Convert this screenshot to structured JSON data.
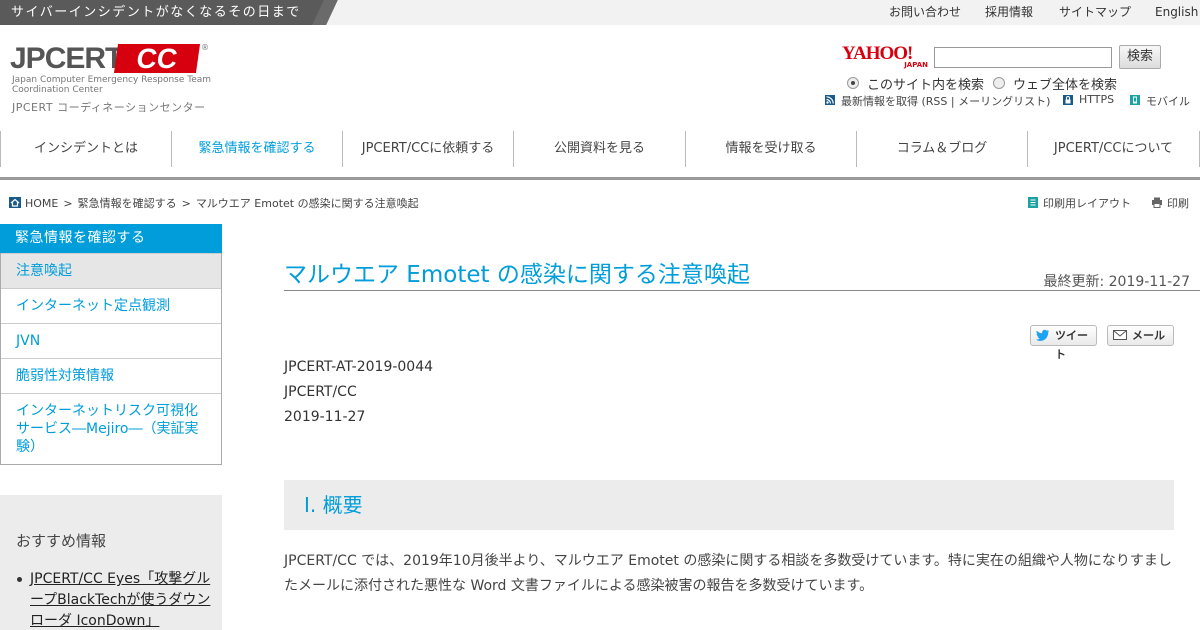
{
  "topbar": {
    "tagline": "サイバーインシデントがなくなるその日まで",
    "links": [
      "お問い合わせ",
      "採用情報",
      "サイトマップ",
      "English"
    ]
  },
  "logo": {
    "name": "JPCERT",
    "badge": "CC",
    "registered": "®",
    "english": "Japan Computer Emergency Response Team Coordination Center",
    "japanese": "JPCERT コーディネーションセンター"
  },
  "search": {
    "provider": "YAHOO!",
    "provider_sub": "JAPAN",
    "value": "",
    "button": "検索",
    "scope_site": "このサイト内を検索",
    "scope_web": "ウェブ全体を検索",
    "selected_scope": "site"
  },
  "utility_links": {
    "rss": "最新情報を取得 (RSS | メーリングリスト)",
    "https": "HTTPS",
    "mobile": "モバイル"
  },
  "nav": {
    "items": [
      "インシデントとは",
      "緊急情報を確認する",
      "JPCERT/CCに依頼する",
      "公開資料を見る",
      "情報を受け取る",
      "コラム＆ブログ",
      "JPCERT/CCについて"
    ],
    "active_index": 1
  },
  "breadcrumb": {
    "home": "HOME",
    "level1": "緊急情報を確認する",
    "current": "マルウエア Emotet の感染に関する注意喚起"
  },
  "print": {
    "layout": "印刷用レイアウト",
    "print": "印刷"
  },
  "sidebar": {
    "heading": "緊急情報を確認する",
    "items": [
      "注意喚起",
      "インターネット定点観測",
      "JVN",
      "脆弱性対策情報",
      "インターネットリスク可視化サービス―Mejiro―（実証実験）"
    ],
    "current_index": 0,
    "recommend_title": "おすすめ情報",
    "recommend_items": [
      "JPCERT/CC Eyes「攻撃グループBlackTechが使うダウンローダ IconDown」"
    ]
  },
  "article": {
    "title": "マルウエア Emotet の感染に関する注意喚起",
    "updated": "最終更新: 2019-11-27",
    "share_tweet": "ツイート",
    "share_mail": "メール",
    "id": "JPCERT-AT-2019-0044",
    "org": "JPCERT/CC",
    "date": "2019-11-27",
    "section1_heading": "I. 概要",
    "section1_text": "JPCERT/CC では、2019年10月後半より、マルウエア Emotet の感染に関する相談を多数受けています。特に実在の組織や人物になりすましたメールに添付された悪性な Word 文書ファイルによる感染被害の報告を多数受けています。"
  },
  "colors": {
    "accent": "#009ddb",
    "brand_red": "#d7000f",
    "topbar": "#5a5a5a"
  }
}
